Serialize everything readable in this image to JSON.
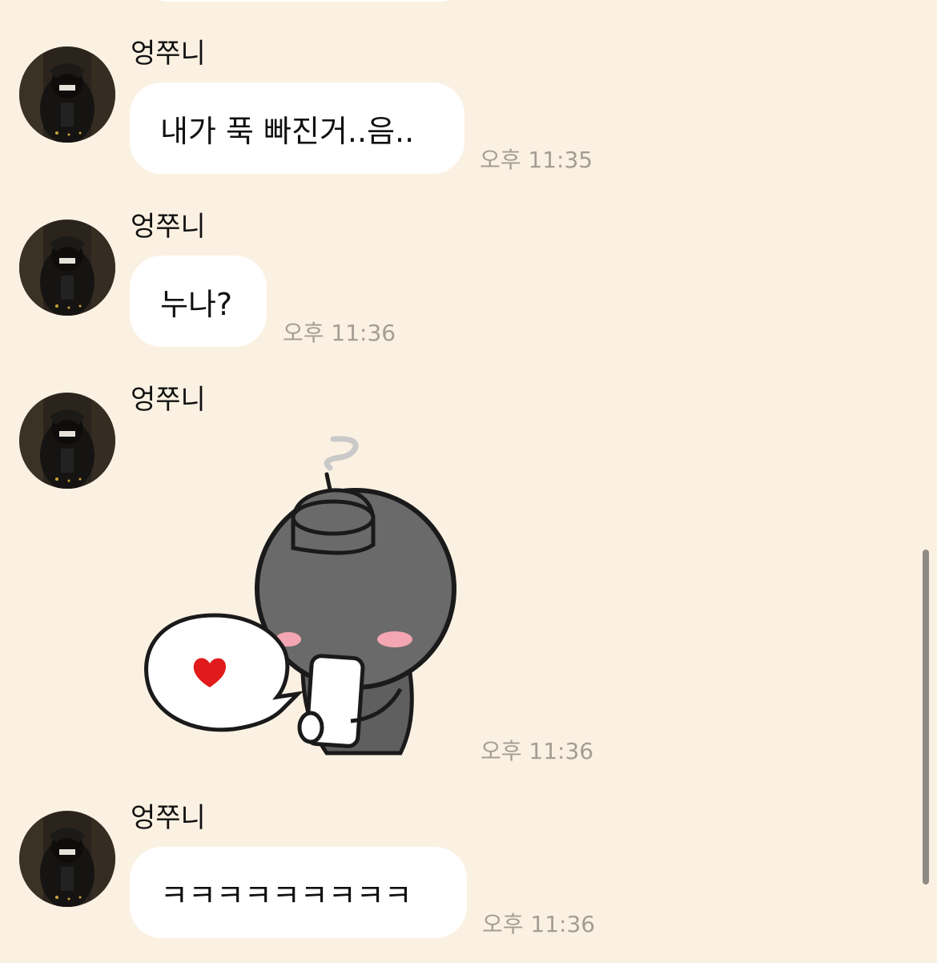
{
  "colors": {
    "background": "#fbf1e2",
    "bubble": "#ffffff",
    "text": "#111111",
    "timestamp": "#a39d94",
    "scrollbar": "#8f8a84"
  },
  "messages": [
    {
      "sender": "엉쭈니",
      "text": "내가 푹 빠진거..음..",
      "time": "오후 11:35",
      "avatar_icon": "profile-photo"
    },
    {
      "sender": "엉쭈니",
      "text": "누나?",
      "time": "오후 11:36",
      "avatar_icon": "profile-photo"
    },
    {
      "sender": "엉쭈니",
      "sticker_icon": "bomb-character-phone-heart-sticker",
      "time": "오후 11:36",
      "avatar_icon": "profile-photo"
    },
    {
      "sender": "엉쭈니",
      "text": "ㅋㅋㅋㅋㅋㅋㅋㅋㅋ",
      "time": "오후 11:36",
      "avatar_icon": "profile-photo"
    }
  ]
}
